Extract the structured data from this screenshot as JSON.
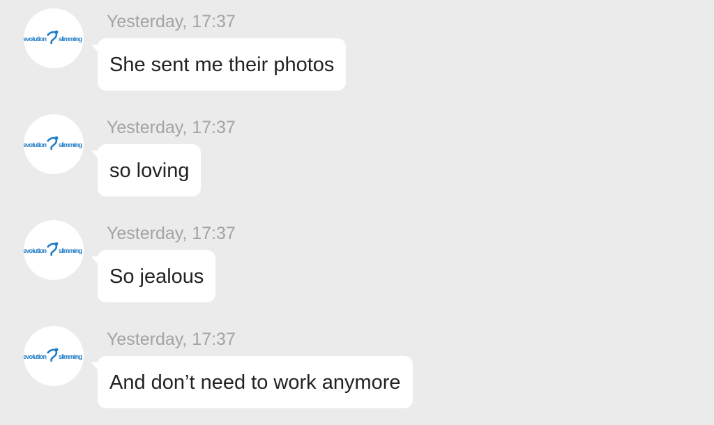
{
  "chat": {
    "messages": [
      {
        "avatar_text": "evolution slimming",
        "timestamp": "Yesterday, 17:37",
        "text": "She sent me their photos"
      },
      {
        "avatar_text": "evolution slimming",
        "timestamp": "Yesterday, 17:37",
        "text": "so loving"
      },
      {
        "avatar_text": "evolution slimming",
        "timestamp": "Yesterday, 17:37",
        "text": "So jealous"
      },
      {
        "avatar_text": "evolution slimming",
        "timestamp": "Yesterday, 17:37",
        "text": "And don’t need to work anymore"
      }
    ]
  },
  "colors": {
    "background": "#ebebeb",
    "bubble": "#ffffff",
    "timestamp": "#a3a3a3",
    "message_text": "#222222",
    "logo_blue": "#1f7cc7"
  }
}
